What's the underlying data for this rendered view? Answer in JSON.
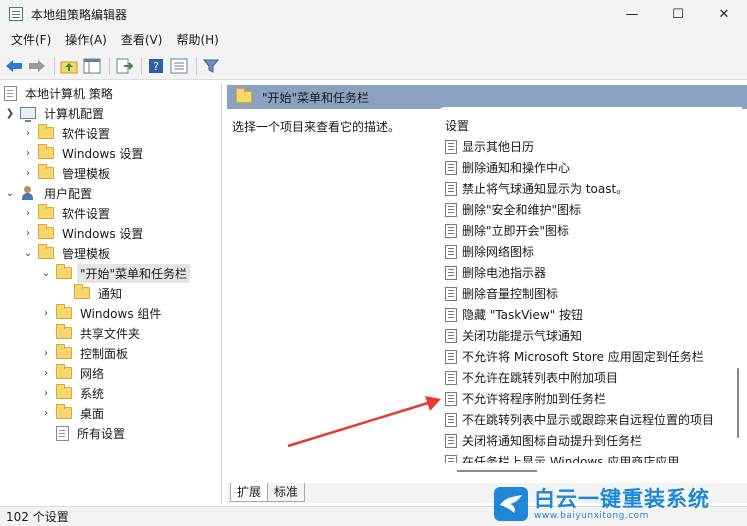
{
  "window": {
    "title": "本地组策略编辑器",
    "minimize": "—",
    "maximize": "☐",
    "close": "✕"
  },
  "menu": [
    "文件(F)",
    "操作(A)",
    "查看(V)",
    "帮助(H)"
  ],
  "tree": {
    "root": "本地计算机 策略",
    "computer_config": "计算机配置",
    "cc_software": "软件设置",
    "cc_windows": "Windows 设置",
    "cc_admin": "管理模板",
    "user_config": "用户配置",
    "uc_software": "软件设置",
    "uc_windows": "Windows 设置",
    "uc_admin": "管理模板",
    "start_taskbar": "\"开始\"菜单和任务栏",
    "notifications": "通知",
    "windows_components": "Windows 组件",
    "shared_folders": "共享文件夹",
    "control_panel": "控制面板",
    "network": "网络",
    "system": "系统",
    "desktop": "桌面",
    "all_settings": "所有设置"
  },
  "content": {
    "header": "\"开始\"菜单和任务栏",
    "description": "选择一个项目来查看它的描述。",
    "list_header": "设置",
    "settings": [
      "显示其他日历",
      "删除通知和操作中心",
      "禁止将气球通知显示为 toast。",
      "删除\"安全和维护\"图标",
      "删除\"立即开会\"图标",
      "删除网络图标",
      "删除电池指示器",
      "删除音量控制图标",
      "隐藏 \"TaskView\" 按钮",
      "关闭功能提示气球通知",
      "不允许将 Microsoft Store 应用固定到任务栏",
      "不允许在跳转列表中附加项目",
      "不允许将程序附加到任务栏",
      "不在跳转列表中显示或跟踪来自远程位置的项目",
      "关闭将通知图标自动提升到任务栏",
      "在任务栏上显示 Windows 应用商店应用"
    ]
  },
  "tabs": [
    "扩展",
    "标准"
  ],
  "status": "102 个设置",
  "watermark": {
    "text": "白云一键重装系统",
    "url": "www.baiyunxitong.com"
  },
  "colors": {
    "header_bar": "#8aa2c0",
    "annotation_arrow": "#e53935",
    "watermark": "#1e88d6"
  }
}
